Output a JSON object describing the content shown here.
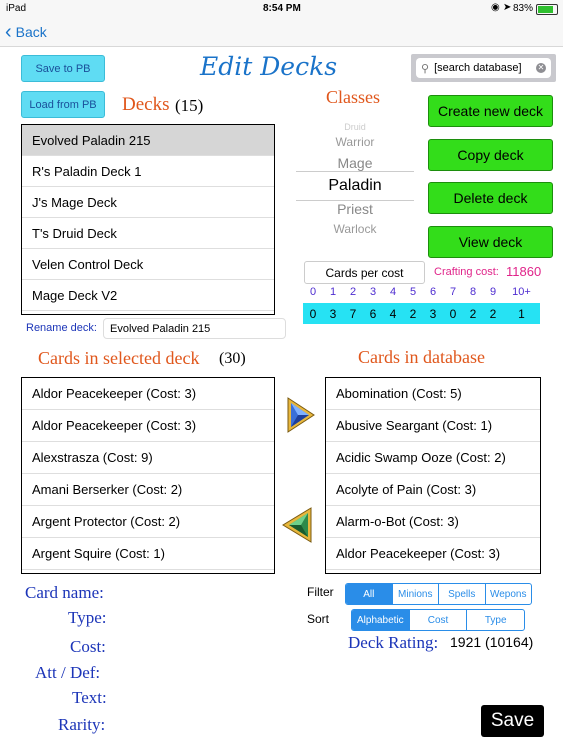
{
  "status_bar": {
    "device": "iPad",
    "time": "8:54 PM",
    "battery": "83%"
  },
  "nav": {
    "back_label": "Back"
  },
  "title": "Edit Decks",
  "buttons": {
    "save_to_pb": "Save to PB",
    "load_from_pb": "Load from PB",
    "create_new_deck": "Create new deck",
    "copy_deck": "Copy deck",
    "delete_deck": "Delete deck",
    "view_deck": "View deck",
    "save": "Save"
  },
  "search": {
    "placeholder": "[search database]"
  },
  "decks": {
    "label": "Decks",
    "count": "(15)",
    "items": [
      "Evolved Paladin 215",
      "R's Paladin Deck 1",
      "J's Mage Deck",
      "T's Druid Deck",
      "Velen Control Deck",
      "Mage Deck V2"
    ]
  },
  "classes": {
    "label": "Classes",
    "picker": [
      "Druid",
      "Warrior",
      "Mage",
      "Paladin",
      "Priest",
      "Warlock"
    ],
    "selected": "Paladin"
  },
  "cards_per_cost": {
    "label": "Cards per cost",
    "costs": [
      "0",
      "1",
      "2",
      "3",
      "4",
      "5",
      "6",
      "7",
      "8",
      "9",
      "10+"
    ],
    "counts": [
      "0",
      "3",
      "7",
      "6",
      "4",
      "2",
      "3",
      "0",
      "2",
      "2",
      "1"
    ]
  },
  "crafting": {
    "label": "Crafting cost:",
    "value": "11860"
  },
  "rename": {
    "label": "Rename deck:",
    "value": "Evolved Paladin 215"
  },
  "selected_deck": {
    "label": "Cards in selected deck",
    "count": "(30)",
    "items": [
      "Aldor Peacekeeper (Cost: 3)",
      "Aldor Peacekeeper (Cost: 3)",
      "Alexstrasza (Cost: 9)",
      "Amani Berserker (Cost: 2)",
      "Argent Protector (Cost: 2)",
      "Argent Squire (Cost: 1)"
    ]
  },
  "database": {
    "label": "Cards in database",
    "items": [
      "Abomination (Cost: 5)",
      "Abusive Seargant (Cost: 1)",
      "Acidic Swamp Ooze (Cost: 2)",
      "Acolyte of Pain (Cost: 3)",
      "Alarm-o-Bot (Cost: 3)",
      "Aldor Peacekeeper (Cost: 3)"
    ]
  },
  "card_info": {
    "name": "Card name:",
    "type": "Type:",
    "cost": "Cost:",
    "att_def": "Att / Def:",
    "text": "Text:",
    "rarity": "Rarity:"
  },
  "filter": {
    "label": "Filter",
    "options": [
      "All",
      "Minions",
      "Spells",
      "Wepons"
    ],
    "selected": "All"
  },
  "sort": {
    "label": "Sort",
    "options": [
      "Alphabetic",
      "Cost",
      "Type"
    ],
    "selected": "Alphabetic"
  },
  "rating": {
    "label": "Deck Rating:",
    "value": "1921 (10164)"
  },
  "colors": {
    "accent_cyan": "#5fdcf3",
    "green": "#33dd1a",
    "title_blue": "#1a73c9",
    "header_orange": "#e0571c",
    "label_blue": "#1c35b8",
    "crafting_pink": "#e0248a",
    "segment_blue": "#2a8de8"
  }
}
